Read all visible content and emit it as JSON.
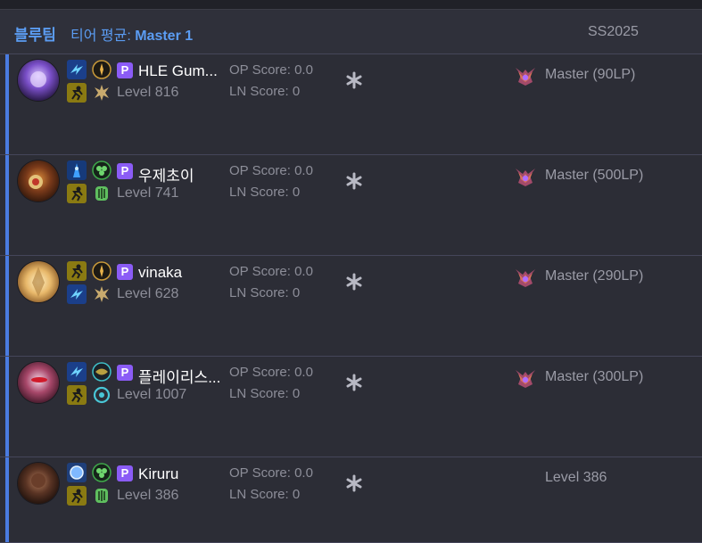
{
  "team": {
    "name": "블루팀",
    "tier_label": "티어 평균: ",
    "tier_value": "Master 1",
    "season": "SS2025"
  },
  "players": [
    {
      "name": "HLE Gum...",
      "level": "Level 816",
      "op_score": "OP Score: 0.0",
      "ln_score": "LN Score: 0",
      "tier": "Master (90LP)",
      "badge": "P",
      "champion_icon": "champion-portrait-purple-icon",
      "spells": [
        "flash-icon",
        "ghost-icon"
      ],
      "runes": [
        "conqueror-rune-icon",
        "precision-rune-icon"
      ]
    },
    {
      "name": "우제초이",
      "level": "Level 741",
      "op_score": "OP Score: 0.0",
      "ln_score": "LN Score: 0",
      "tier": "Master (500LP)",
      "badge": "P",
      "champion_icon": "champion-portrait-armor-icon",
      "spells": [
        "teleport-icon",
        "ghost-icon"
      ],
      "runes": [
        "grasp-rune-icon",
        "resolve-rune-icon"
      ]
    },
    {
      "name": "vinaka",
      "level": "Level 628",
      "op_score": "OP Score: 0.0",
      "ln_score": "LN Score: 0",
      "tier": "Master (290LP)",
      "badge": "P",
      "champion_icon": "champion-portrait-gold-icon",
      "spells": [
        "ghost-icon",
        "flash-icon"
      ],
      "runes": [
        "conqueror-rune-icon",
        "precision-rune-icon"
      ]
    },
    {
      "name": "플레이리스...",
      "level": "Level 1007",
      "op_score": "OP Score: 0.0",
      "ln_score": "LN Score: 0",
      "tier": "Master (300LP)",
      "badge": "P",
      "champion_icon": "champion-portrait-pink-icon",
      "spells": [
        "flash-icon",
        "ghost-icon"
      ],
      "runes": [
        "first-strike-rune-icon",
        "inspiration-rune-icon"
      ]
    },
    {
      "name": "Kiruru",
      "level": "Level 386",
      "op_score": "OP Score: 0.0",
      "ln_score": "LN Score: 0",
      "tier": "",
      "tier_fallback": "Level 386",
      "badge": "P",
      "champion_icon": "champion-portrait-dark-icon",
      "spells": [
        "barrier-icon",
        "ghost-icon"
      ],
      "runes": [
        "grasp-rune-icon",
        "resolve-rune-icon"
      ]
    }
  ],
  "colors": {
    "accent": "#4a7be0",
    "team_blue": "#5b9cf2",
    "badge_purple": "#8b5cf6",
    "background": "#2c2d36"
  }
}
